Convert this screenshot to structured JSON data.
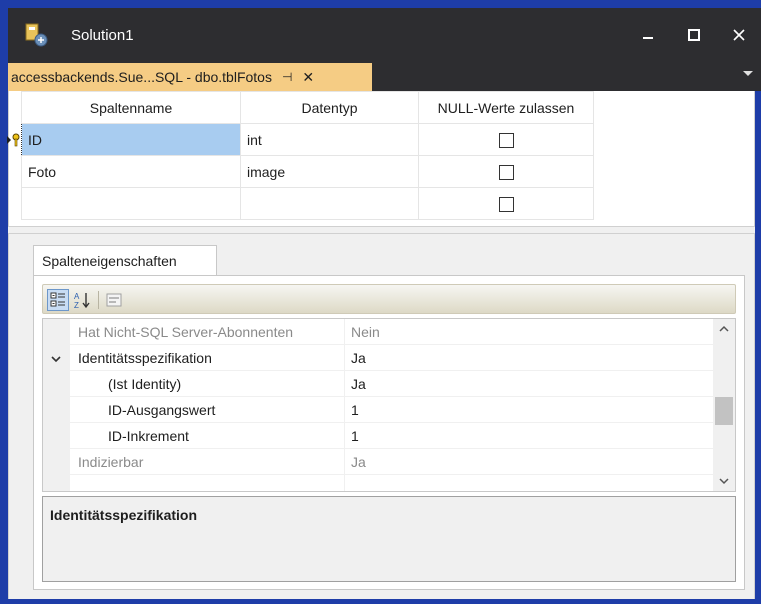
{
  "window": {
    "title": "Solution1",
    "controls": {
      "minimize": "minimize-icon",
      "maximize": "maximize-icon",
      "close": "close-icon"
    }
  },
  "doc_tab": {
    "label": "accessbackends.Sue...SQL - dbo.tblFotos",
    "pin_glyph": "⊣",
    "close_glyph": "✕"
  },
  "table_grid": {
    "headers": [
      "Spaltenname",
      "Datentyp",
      "NULL-Werte zulassen"
    ],
    "rows": [
      {
        "name": "ID",
        "type": "int",
        "allow_null": false,
        "primary_key": true,
        "selected": true
      },
      {
        "name": "Foto",
        "type": "image",
        "allow_null": false,
        "primary_key": false,
        "selected": false
      },
      {
        "name": "",
        "type": "",
        "allow_null": false,
        "primary_key": false,
        "selected": false
      }
    ]
  },
  "properties": {
    "tab_label": "Spalteneigenschaften",
    "rows": [
      {
        "name": "Hat Nicht-SQL Server-Abonnenten",
        "value": "Nein",
        "style": "gray"
      },
      {
        "name": "Identitätsspezifikation",
        "value": "Ja",
        "style": "expanded"
      },
      {
        "name": "(Ist Identity)",
        "value": "Ja",
        "style": "sub"
      },
      {
        "name": "ID-Ausgangswert",
        "value": "1",
        "style": "sub"
      },
      {
        "name": "ID-Inkrement",
        "value": "1",
        "style": "sub"
      },
      {
        "name": "Indizierbar",
        "value": "Ja",
        "style": "gray"
      }
    ],
    "description_title": "Identitätsspezifikation"
  },
  "colors": {
    "window_border": "#1e3da8",
    "title_bar": "#2d2d30",
    "active_tab": "#f5cc84",
    "selection": "#a8ccf0"
  }
}
